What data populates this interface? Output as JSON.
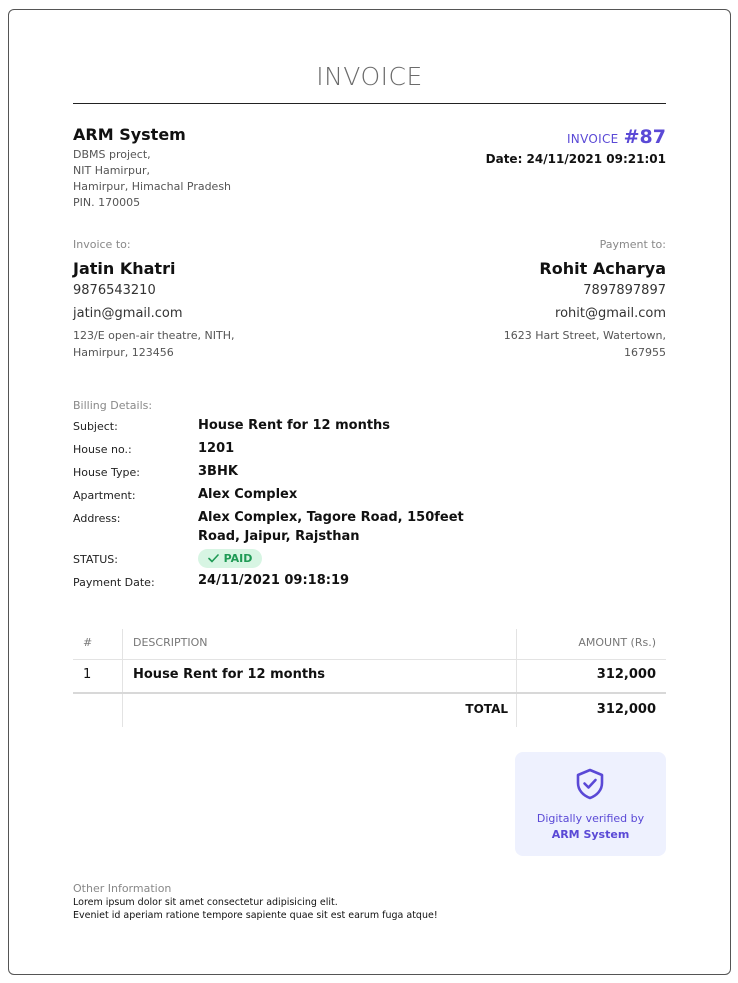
{
  "invoice": {
    "heading": "INVOICE",
    "label": "INVOICE",
    "number": "#87",
    "date": "Date: 24/11/2021 09:21:01"
  },
  "company": {
    "name": "ARM System",
    "address": [
      "DBMS project,",
      "NIT Hamirpur,",
      "Hamirpur, Himachal Pradesh",
      "PIN. 170005"
    ]
  },
  "invoice_to": {
    "label": "Invoice to:",
    "name": "Jatin Khatri",
    "phone": "9876543210",
    "email": "jatin@gmail.com",
    "address": [
      "123/E open-air theatre, NITH,",
      "Hamirpur, 123456"
    ]
  },
  "payment_to": {
    "label": "Payment to:",
    "name": "Rohit Acharya",
    "phone": "7897897897",
    "email": "rohit@gmail.com",
    "address": [
      "1623 Hart Street, Watertown,",
      "167955"
    ]
  },
  "billing": {
    "label": "Billing Details:",
    "subject_label": "Subject:",
    "subject": "House Rent for 12 months",
    "house_no_label": "House no.:",
    "house_no": "1201",
    "house_type_label": "House Type:",
    "house_type": "3BHK",
    "apartment_label": "Apartment:",
    "apartment": "Alex Complex",
    "address_label": "Address:",
    "address": [
      "Alex Complex, Tagore Road, 150feet",
      "Road, Jaipur, Rajsthan"
    ],
    "status_label": "STATUS:",
    "status": "PAID",
    "payment_date_label": "Payment Date:",
    "payment_date": "24/11/2021 09:18:19"
  },
  "table": {
    "headers": [
      "#",
      "DESCRIPTION",
      "AMOUNT (Rs.)"
    ],
    "rows": [
      {
        "index": "1",
        "description": "House Rent for 12 months",
        "amount": "312,000"
      }
    ],
    "total_label": "TOTAL",
    "total": "312,000"
  },
  "verification": {
    "line1": "Digitally verified by",
    "line2": "ARM System"
  },
  "other": {
    "heading": "Other Information",
    "lines": [
      "Lorem ipsum dolor sit amet consectetur adipisicing elit.",
      "Eveniet id aperiam ratione tempore sapiente quae sit est earum fuga atque!"
    ]
  },
  "colors": {
    "accent": "#5a49d6",
    "paid_bg": "#d7f5e3",
    "paid_text": "#1f9a55",
    "verify_bg": "#eef1fe"
  }
}
